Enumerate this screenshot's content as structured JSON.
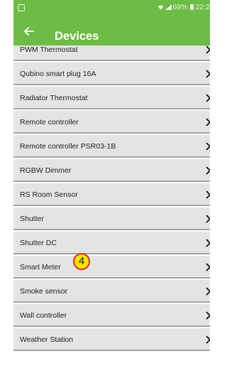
{
  "status_bar": {
    "battery_percent": "69%",
    "time": "22:2"
  },
  "app_bar": {
    "title": "Devices"
  },
  "devices": [
    "PWM Thermostat",
    "Qubino smart plug 16A",
    "Radiator Thermostat",
    "Remote controller",
    "Remote controller PSR03-1B",
    "RGBW Dimmer",
    "RS Room Sensor",
    "Shutter",
    "Shutter DC",
    "Smart Meter",
    "Smoke sensor",
    "Wall controller",
    "Weather Station"
  ],
  "annotation": {
    "label": "4"
  },
  "colors": {
    "accent": "#6cbc45",
    "row_bg": "#e4e4e4",
    "divider": "#a3a3a3",
    "badge_fill": "#ffe400",
    "badge_border": "#e0272b"
  },
  "icons": {
    "back": "arrow-left-icon",
    "chevron": "chevron-right-icon"
  }
}
